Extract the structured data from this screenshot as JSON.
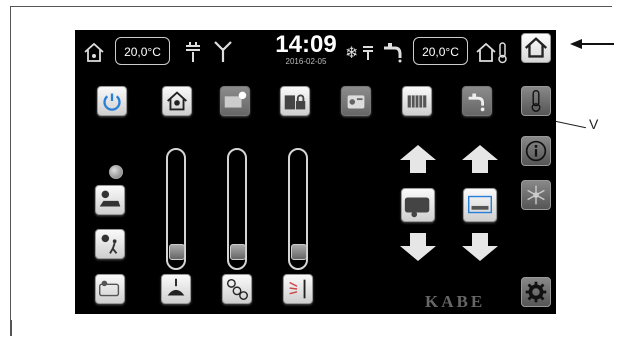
{
  "header": {
    "inside_temp": "20,0°C",
    "time": "14:09",
    "date": "2016-02-05",
    "outside_temp": "20,0°C"
  },
  "brand": "KABE",
  "callout": "V",
  "toolbar_icons": [
    "power-icon",
    "interior-light-icon",
    "exterior-light-icon",
    "lock-icon",
    "radio-icon",
    "heater-icon",
    "water-pump-icon"
  ],
  "left_column_icons": [
    "bed-light-icon",
    "entrance-light-icon",
    "awning-light-icon"
  ],
  "sliders": [
    {
      "name": "ceiling-light",
      "level": 0.08
    },
    {
      "name": "spot-lights",
      "level": 0.08
    },
    {
      "name": "wall-light",
      "level": 0.08
    }
  ],
  "levelers": [
    "vehicle-leveling",
    "bed-lift"
  ],
  "sidebar": [
    "home",
    "thermometer",
    "info",
    "climate",
    "settings"
  ]
}
